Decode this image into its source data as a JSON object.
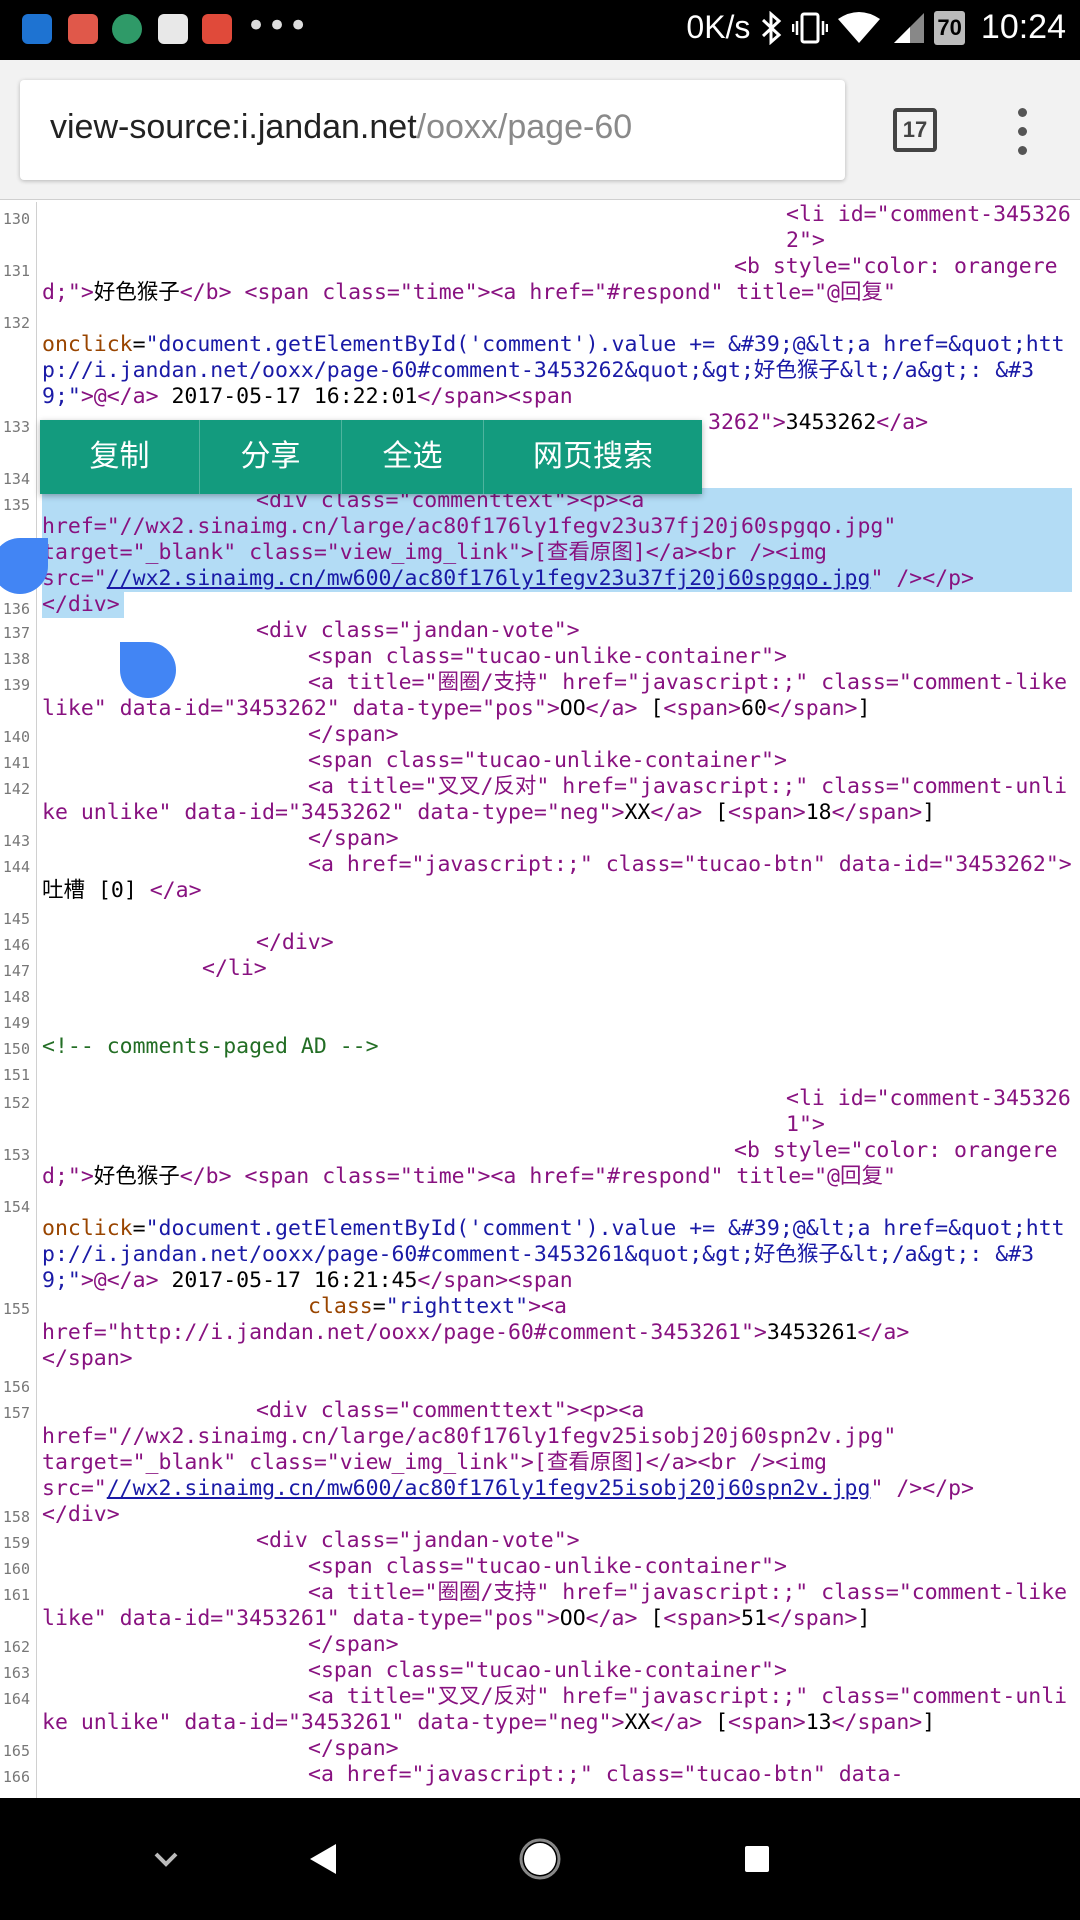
{
  "status_bar": {
    "speed": "0K/s",
    "battery": "70",
    "time": "10:24",
    "notification_icons": [
      "note-app-icon",
      "mail-app-icon",
      "travel-app-icon",
      "book-app-icon",
      "tool-app-icon"
    ],
    "more": "•••"
  },
  "browser": {
    "url_host": "view-source:i.jandan.net",
    "url_path": "/ooxx/page-60",
    "tab_count": "17"
  },
  "context_menu": {
    "copy": "复制",
    "share": "分享",
    "select_all": "全选",
    "web_search": "网页搜索"
  },
  "source": {
    "line_numbers": [
      "130",
      "131",
      "132",
      "133",
      "134",
      "135",
      "136",
      "137",
      "138",
      "139",
      "140",
      "141",
      "142",
      "143",
      "144",
      "145",
      "146",
      "147",
      "148",
      "149",
      "150",
      "151",
      "152",
      "153",
      "154",
      "155",
      "156",
      "157",
      "158",
      "159",
      "160",
      "161",
      "162",
      "163",
      "164",
      "165",
      "166"
    ],
    "comment_1": {
      "li_open": "<li id=\"comment-3453262\">",
      "b_open": "<b style=\"color: orangered;\">",
      "author": "好色猴子",
      "b_close": "</b>",
      "span_time": "<span class=\"time\">",
      "a_respond": "<a href=\"#respond\" title=\"@回复\"",
      "onclick_attr": "onclick",
      "onclick_val": "\"document.getElementById('comment').value += &#39;@&lt;a href=&quot;http://i.jandan.net/ooxx/page-60#comment-3453262&quot;&gt;好色猴子&lt;/a&gt;: &#39;\"",
      "at": ">@",
      "a_close": "</a>",
      "datetime": " 2017-05-17 16:22:01",
      "span_close": "</span>",
      "span_open2": "<span",
      "rt_line": "class=\"righttext\"><a href=\"http://i.jandan.net/ooxx/page-60#comment-3453262\">3453262</a>",
      "rt_partial_tag": "3262\">",
      "rt_id": "3453262",
      "rt_a_close": "</a>",
      "div_commenttext": "<div class=\"commenttext\"><p><a",
      "href_large": "href=\"//wx2.sinaimg.cn/large/ac80f176ly1fegv23u37fj20j60spgqo.jpg\"",
      "target_line": "target=\"_blank\" class=\"view_img_link\">[查看原图]</a><br /><img",
      "src_prefix": "src=\"",
      "src_url": "//wx2.sinaimg.cn/mw600/ac80f176ly1fegv23u37fj20j60spgqo.jpg",
      "src_suffix": "\" /></p>",
      "div_close": "</div>",
      "vote_div": "<div class=\"jandan-vote\">",
      "tucao_span": "<span class=\"tucao-unlike-container\">",
      "like_a": "<a title=\"圈圈/支持\" href=\"javascript:;\" class=\"comment-like like\" data-id=\"3453262\" data-type=\"pos\">",
      "oo": "OO",
      "like_count": "60",
      "unlike_a": "<a title=\"叉叉/反对\" href=\"javascript:;\" class=\"comment-unlike unlike\" data-id=\"3453262\" data-type=\"neg\">",
      "xx": "XX",
      "unlike_count": "18",
      "tucao_a": "<a href=\"javascript:;\" class=\"tucao-btn\" data-id=\"3453262\">",
      "tucao_text": " 吐槽 [0] ",
      "vote_close": "</div>",
      "li_close": "</li>"
    },
    "ad_comment": "<!-- comments-paged AD -->",
    "comment_2": {
      "li_open": "<li id=\"comment-3453261\">",
      "onclick_val": "\"document.getElementById('comment').value += &#39;@&lt;a href=&quot;http://i.jandan.net/ooxx/page-60#comment-3453261&quot;&gt;好色猴子&lt;/a&gt;: &#39;\"",
      "datetime": " 2017-05-17 16:21:45",
      "rt_href": "href=\"http://i.jandan.net/ooxx/page-60#comment-3453261\">",
      "rt_id": "3453261",
      "href_large": "href=\"//wx2.sinaimg.cn/large/ac80f176ly1fegv25isobj20j60spn2v.jpg\"",
      "src_url": "//wx2.sinaimg.cn/mw600/ac80f176ly1fegv25isobj20j60spn2v.jpg",
      "like_a": "<a title=\"圈圈/支持\" href=\"javascript:;\" class=\"comment-like like\" data-id=\"3453261\" data-type=\"pos\">",
      "like_count": "51",
      "unlike_a": "<a title=\"叉叉/反对\" href=\"javascript:;\" class=\"comment-unlike unlike\" data-id=\"3453261\" data-type=\"neg\">",
      "unlike_count": "13",
      "tucao_partial": "<a href=\"javascript:;\" class=\"tucao-btn\" data-"
    }
  },
  "colors": {
    "selection": "#b3dcf5",
    "context_menu": "#139b7e",
    "handle": "#4285f4",
    "tag": "#881280",
    "attribute": "#994500",
    "value": "#1a1aa6",
    "comment": "#236e25"
  }
}
